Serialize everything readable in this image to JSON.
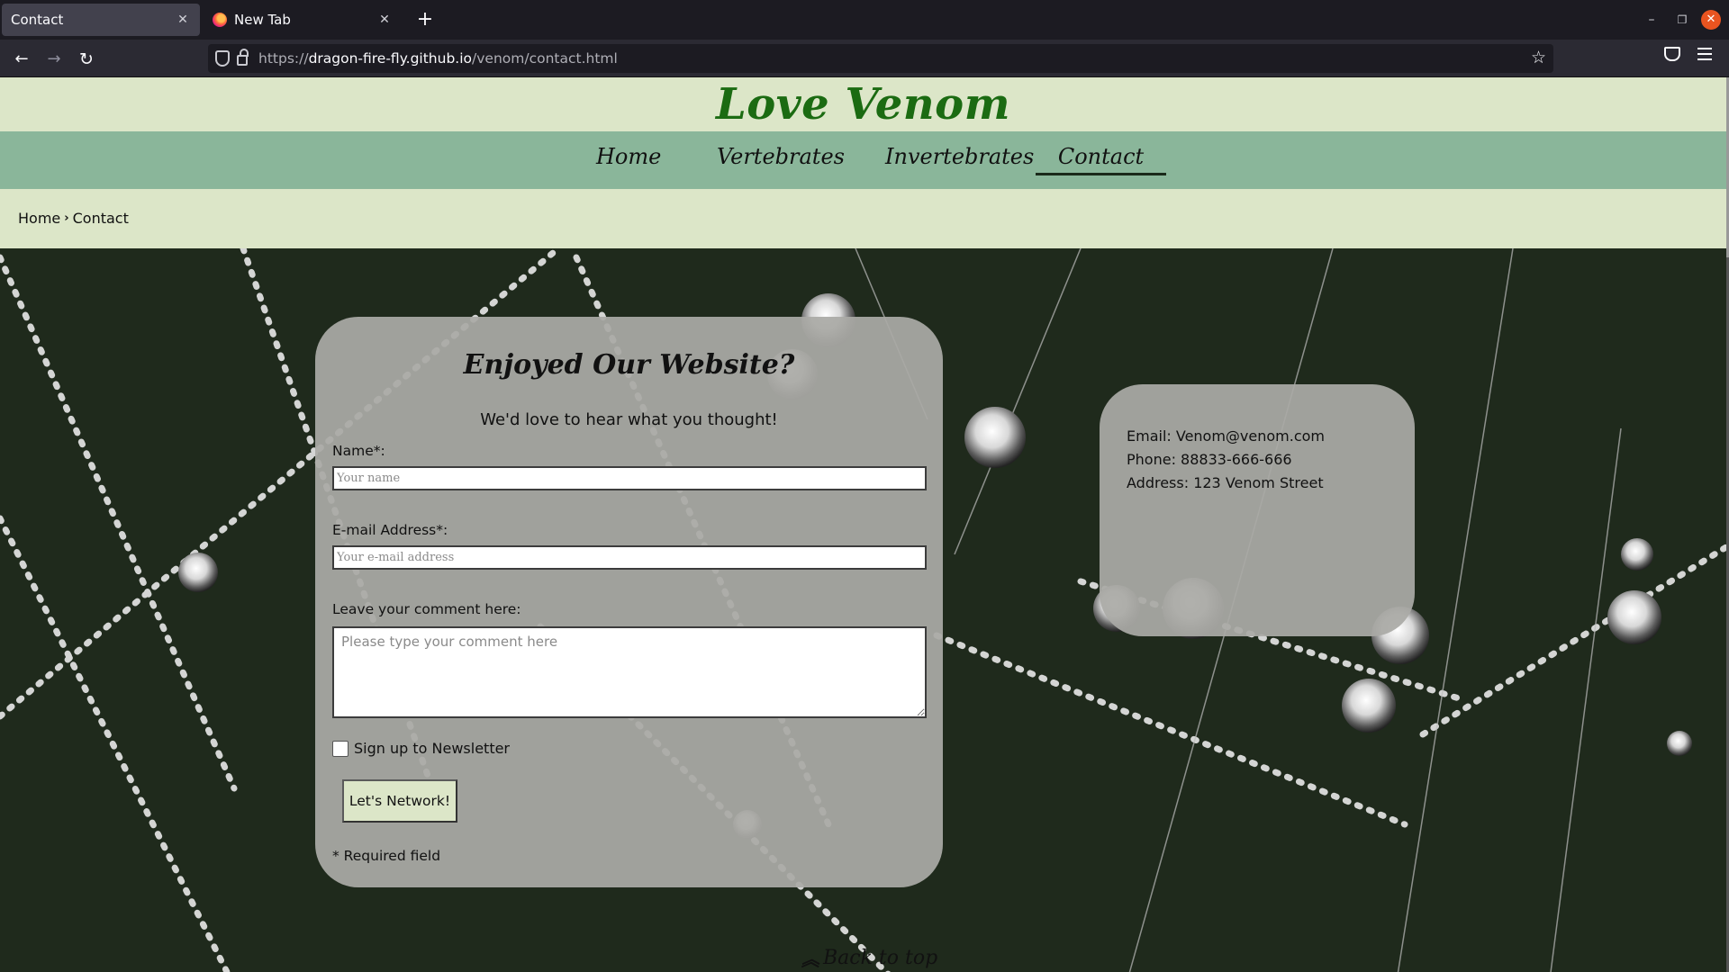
{
  "browser": {
    "tabs": [
      {
        "label": "Contact",
        "active": true
      },
      {
        "label": "New Tab",
        "active": false
      }
    ],
    "url_prefix": "https://",
    "url_host": "dragon-fire-fly.github.io",
    "url_path": "/venom/contact.html",
    "icons": [
      "firefox-icon",
      "close-icon",
      "plus-icon",
      "back-arrow-icon",
      "forward-arrow-icon",
      "reload-icon",
      "shield-icon",
      "lock-icon",
      "star-icon",
      "pocket-icon",
      "menu-icon"
    ]
  },
  "site": {
    "title": "Love Venom",
    "nav": [
      "Home",
      "Vertebrates",
      "Invertebrates",
      "Contact"
    ],
    "nav_current": "Contact",
    "breadcrumb": {
      "home": "Home",
      "current": "Contact"
    }
  },
  "form": {
    "title": "Enjoyed Our Website?",
    "subtitle": "We'd love to hear what you thought!",
    "name_label": "Name*:",
    "name_placeholder": "Your name",
    "email_label": "E-mail Address*:",
    "email_placeholder": "Your e-mail address",
    "comment_label": "Leave your comment here:",
    "comment_placeholder": "Please type your comment here",
    "newsletter_label": "Sign up to Newsletter",
    "submit_label": "Let's Network!",
    "required_note": "* Required field"
  },
  "contact_info": {
    "email": "Email: Venom@venom.com",
    "phone": "Phone: 88833-666-666",
    "address": "Address: 123 Venom Street"
  },
  "footer": {
    "back_to_top": "Back to top"
  },
  "colors": {
    "header_bg": "#dce6c8",
    "nav_bg": "#8ab69a",
    "title_green": "#1b6b12",
    "card_bg": "#aaaaa6"
  }
}
